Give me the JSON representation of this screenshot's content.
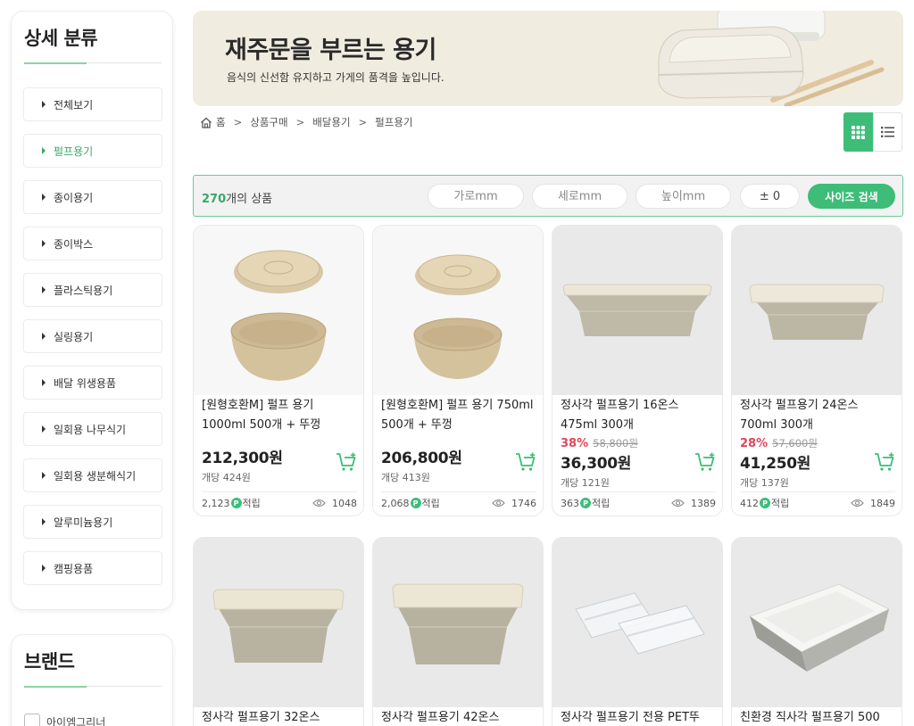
{
  "sidebar": {
    "title": "상세 분류",
    "items": [
      {
        "label": "전체보기"
      },
      {
        "label": "펄프용기"
      },
      {
        "label": "종이용기"
      },
      {
        "label": "종이박스"
      },
      {
        "label": "플라스틱용기"
      },
      {
        "label": "실링용기"
      },
      {
        "label": "배달 위생용품"
      },
      {
        "label": "일회용 나무식기"
      },
      {
        "label": "일회용 생분해식기"
      },
      {
        "label": "알루미늄용기"
      },
      {
        "label": "캠핑용품"
      }
    ],
    "active_item": "펄프용기",
    "accent_color": "#3aa86b"
  },
  "brand": {
    "title": "브랜드",
    "options": [
      {
        "label": "아이엠그리너"
      }
    ]
  },
  "banner": {
    "title": "재주문을 부르는 용기",
    "subtitle": "음식의 신선함 유지하고 가게의 품격을 높입니다.",
    "background": "#f1ece0"
  },
  "breadcrumb": {
    "items": [
      "홈",
      "상품구매",
      "배달용기",
      "펄프용기"
    ],
    "icon": "home-icon"
  },
  "view_toggle": {
    "grid_icon": "grid-view-icon",
    "list_icon": "list-view-icon",
    "active": "grid"
  },
  "filter": {
    "count_number": "270",
    "count_suffix": "개의 상품",
    "width_placeholder": "가로mm",
    "depth_placeholder": "세로mm",
    "height_placeholder": "높이mm",
    "tolerance_value": "± 0",
    "search_label": "사이즈 검색"
  },
  "products": [
    {
      "name": "[원형호환M] 펄프 용기 1000ml 500개 + 뚜껑",
      "discount_rate": "",
      "original_price": "",
      "price": "212,300원",
      "unit_price": "개당 424원",
      "points": "2,123",
      "points_suffix": "적립",
      "views": "1048"
    },
    {
      "name": "[원형호환M] 펄프 용기 750ml 500개 + 뚜껑",
      "discount_rate": "",
      "original_price": "",
      "price": "206,800원",
      "unit_price": "개당 413원",
      "points": "2,068",
      "points_suffix": "적립",
      "views": "1746"
    },
    {
      "name": "정사각 펄프용기 16온스 475ml 300개",
      "discount_rate": "38%",
      "original_price": "58,800원",
      "price": "36,300원",
      "unit_price": "개당 121원",
      "points": "363",
      "points_suffix": "적립",
      "views": "1389"
    },
    {
      "name": "정사각 펄프용기 24온스 700ml 300개",
      "discount_rate": "28%",
      "original_price": "57,600원",
      "price": "41,250원",
      "unit_price": "개당 137원",
      "points": "412",
      "points_suffix": "적립",
      "views": "1849"
    },
    {
      "name": "정사각 펄프용기 32온스"
    },
    {
      "name": "정사각 펄프용기 42온스"
    },
    {
      "name": "정사각 펄프용기 전용 PET뚜"
    },
    {
      "name": "친환경 직사각 펄프용기 500"
    }
  ],
  "colors": {
    "brand_green": "#3dbd78",
    "discount_red": "#e0455a"
  }
}
